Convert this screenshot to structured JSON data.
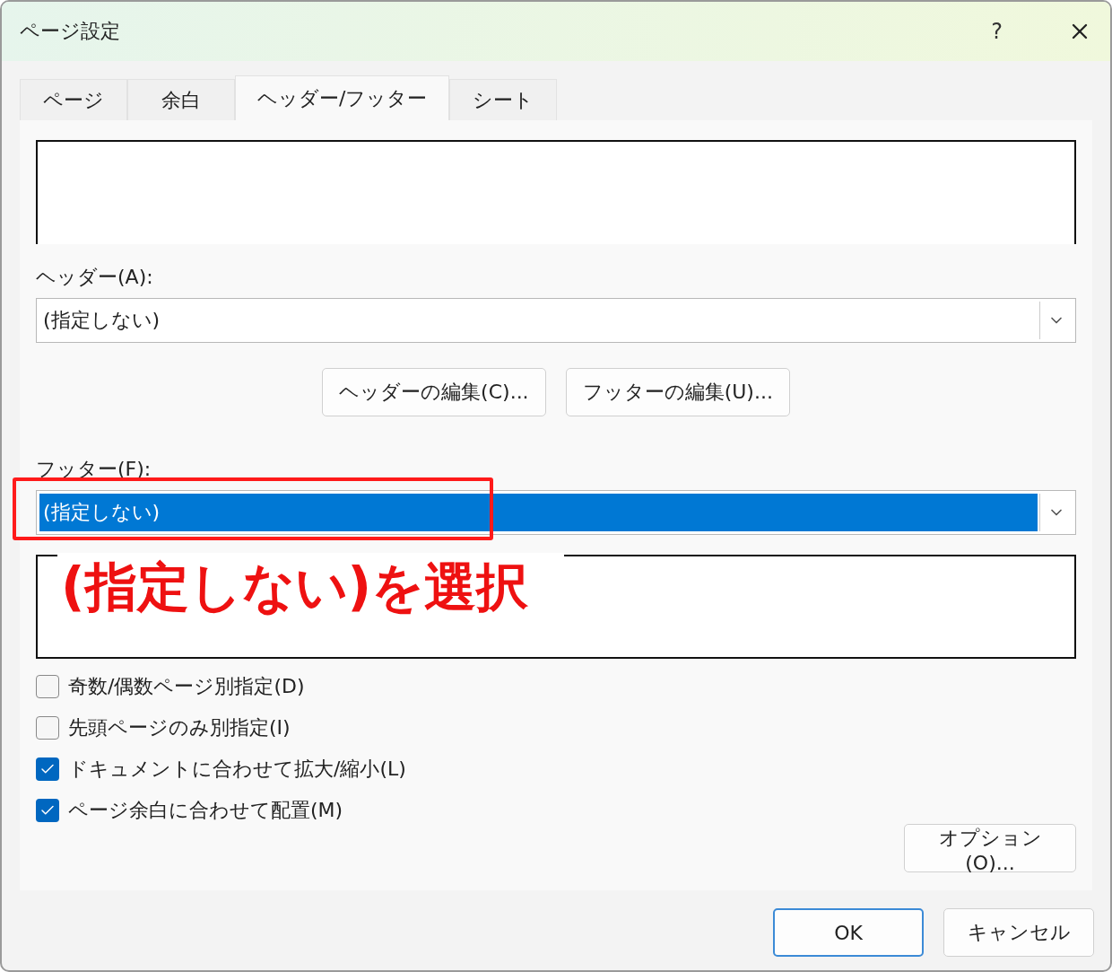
{
  "window": {
    "title": "ページ設定",
    "help": "?"
  },
  "tabs": [
    {
      "label": "ページ",
      "selected": false
    },
    {
      "label": "余白",
      "selected": false
    },
    {
      "label": "ヘッダー/フッター",
      "selected": true
    },
    {
      "label": "シート",
      "selected": false
    }
  ],
  "header": {
    "label": "ヘッダー(A):",
    "value": "(指定しない)",
    "highlighted": false
  },
  "edit_buttons": [
    "ヘッダーの編集(C)...",
    "フッターの編集(U)..."
  ],
  "footer": {
    "label": "フッター(F):",
    "value": "(指定しない)",
    "highlighted": true
  },
  "annotation": {
    "text": "(指定しない)を選択"
  },
  "checkboxes": [
    {
      "label": "奇数/偶数ページ別指定(D)",
      "checked": false
    },
    {
      "label": "先頭ページのみ別指定(I)",
      "checked": false
    },
    {
      "label": "ドキュメントに合わせて拡大/縮小(L)",
      "checked": true
    },
    {
      "label": "ページ余白に合わせて配置(M)",
      "checked": true
    }
  ],
  "options_button": "オプション(O)...",
  "buttons": [
    {
      "label": "OK",
      "default": true
    },
    {
      "label": "キャンセル",
      "default": false
    }
  ]
}
